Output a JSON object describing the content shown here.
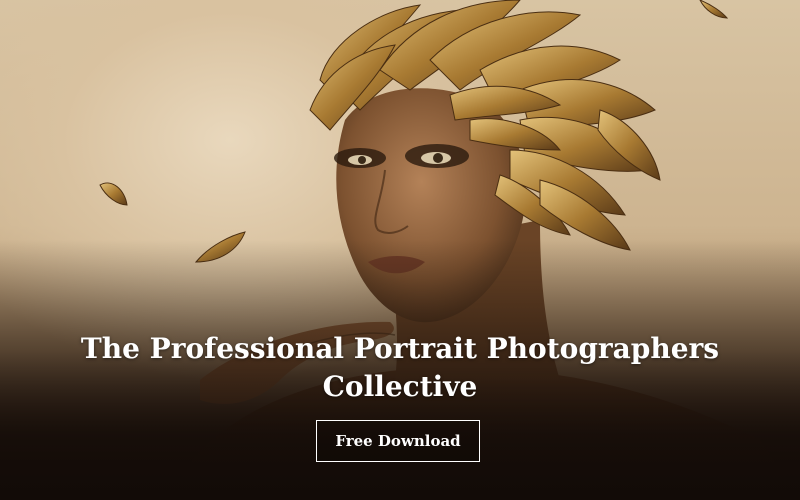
{
  "hero": {
    "headline": "The Professional Portrait Photographers Collective",
    "cta_label": "Free Download"
  },
  "photo": {
    "subject": "portrait-with-golden-feather-headdress",
    "colors": {
      "backdrop": "#d8c4a3",
      "skin": "#8a5a35",
      "feather_gold": "#b88a3a",
      "shadow": "#1d120c"
    }
  }
}
